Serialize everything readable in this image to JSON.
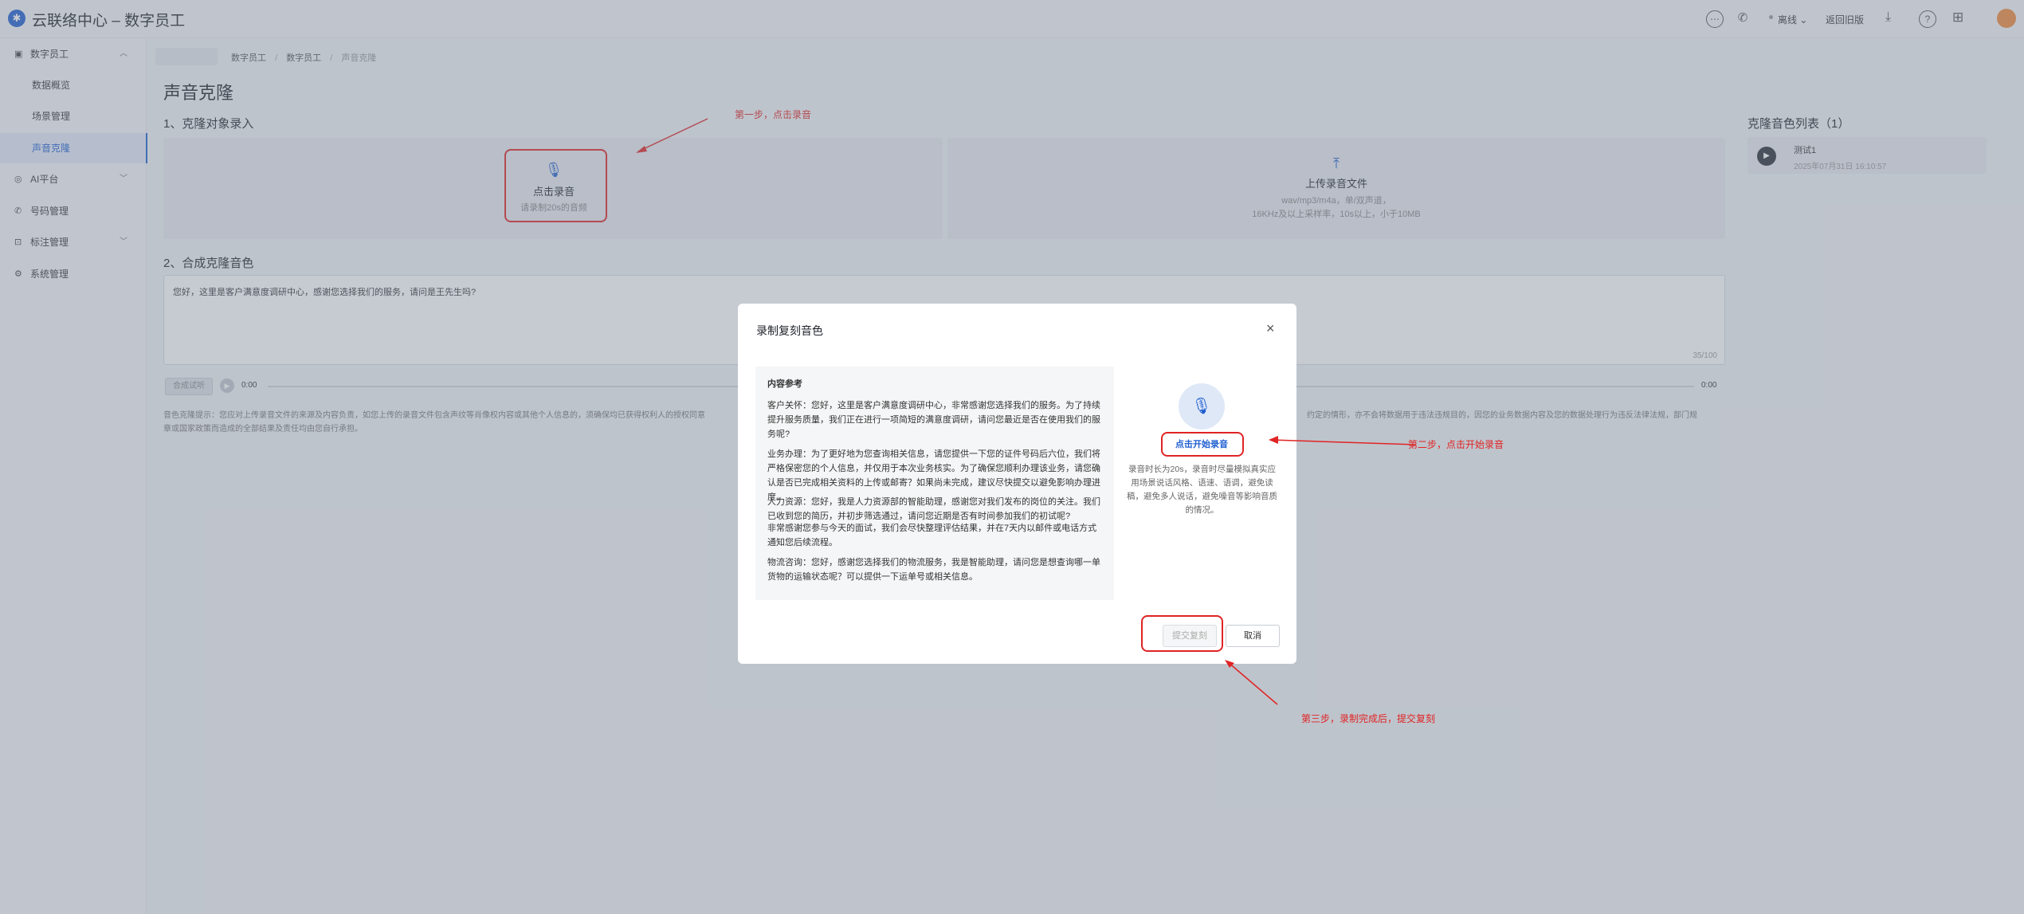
{
  "header": {
    "app_title": "云联络中心 – 数字员工",
    "status_label": "离线",
    "back_label": "返回旧版"
  },
  "sidebar": {
    "group_digital": "数字员工",
    "items": [
      "数据概览",
      "场景管理",
      "声音克隆"
    ],
    "ai_platform": "AI平台",
    "number_mgmt": "号码管理",
    "label_mgmt": "标注管理",
    "system_mgmt": "系统管理"
  },
  "breadcrumb": [
    "数字员工",
    "数字员工",
    "声音克隆"
  ],
  "page_title": "声音克隆",
  "section1": {
    "title": "1、克隆对象录入",
    "record_title": "点击录音",
    "record_sub": "请录制20s的音频",
    "upload_title": "上传录音文件",
    "upload_line1": "wav/mp3/m4a，单/双声道，",
    "upload_line2": "16KHz及以上采样率，10s以上，小于10MB"
  },
  "section2": {
    "title": "2、合成克隆音色",
    "text_value": "您好，这里是客户满意度调研中心，感谢您选择我们的服务，请问是王先生吗?",
    "char_count": "35/100",
    "synth_button": "合成试听",
    "time_start": "0:00",
    "time_end": "0:00",
    "notice_line1": "音色克隆提示：您应对上传录音文件的来源及内容负责，如您上传的录音文件包含声纹等肖像权内容或其他个人信息的，须确保均已获得权利人的授权同意",
    "notice_line1_tail": "约定的情形，亦不会将数据用于违法违规目的，因您的业务数据内容及您的数据处理行为违反法律法规，部门规",
    "notice_line2": "章或国家政策而造成的全部结果及责任均由您自行承担。"
  },
  "clone_list": {
    "title": "克隆音色列表（1）",
    "items": [
      {
        "name": "测试1",
        "time": "2025年07月31日 16:10:57"
      }
    ]
  },
  "modal": {
    "title": "录制复刻音色",
    "ref_heading": "内容参考",
    "para1": "客户关怀：您好，这里是客户满意度调研中心，非常感谢您选择我们的服务。为了持续提升服务质量，我们正在进行一项简短的满意度调研，请问您最近是否在使用我们的服务呢?",
    "para2": "业务办理：为了更好地为您查询相关信息，请您提供一下您的证件号码后六位，我们将严格保密您的个人信息，并仅用于本次业务核实。为了确保您顺利办理该业务，请您确认是否已完成相关资料的上传或邮寄？如果尚未完成，建议尽快提交以避免影响办理进度。",
    "para3a": "人力资源：您好，我是人力资源部的智能助理，感谢您对我们发布的岗位的关注。我们已收到您的简历，并初步筛选通过，请问您近期是否有时间参加我们的初试呢?",
    "para3b": "非常感谢您参与今天的面试，我们会尽快整理评估结果，并在7天内以邮件或电话方式通知您后续流程。",
    "para4": "物流咨询：您好，感谢您选择我们的物流服务，我是智能助理，请问您是想查询哪一单货物的运输状态呢？可以提供一下运单号或相关信息。",
    "start_record": "点击开始录音",
    "tips": "录音时长为20s，录音时尽量模拟真实应用场景说话风格、语速、语调，避免读稿，避免多人说话，避免噪音等影响音质的情况。",
    "submit": "提交复刻",
    "cancel": "取消"
  },
  "annotations": {
    "step1": "第一步，点击录音",
    "step2": "第二步，点击开始录音",
    "step3": "第三步，录制完成后，提交复刻"
  },
  "colors": {
    "accent": "#1f5fd1",
    "annotation": "#e02424"
  }
}
